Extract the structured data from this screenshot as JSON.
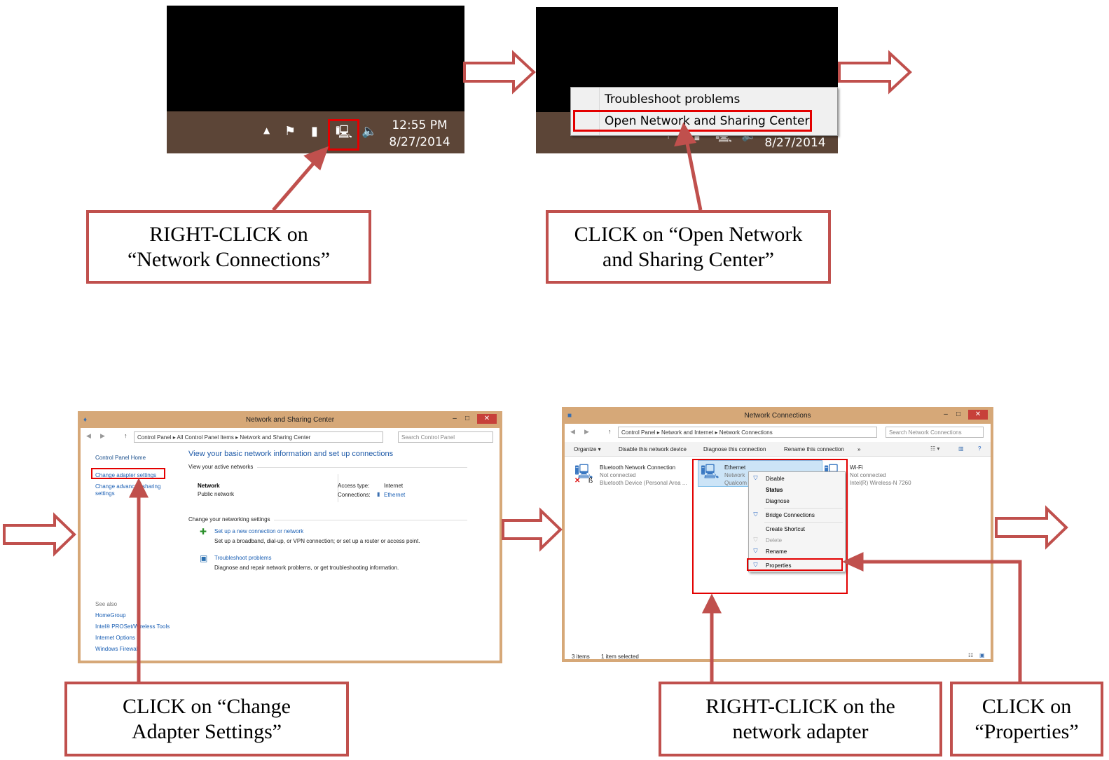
{
  "colors": {
    "arrow": "#c0504d",
    "highlight": "#e30000",
    "taskbar": "#5c4537",
    "window_frame": "#d6a878"
  },
  "step1": {
    "time": "12:55 PM",
    "date": "8/27/2014",
    "icons": [
      "up-triangle-icon",
      "flag-icon",
      "battery-icon",
      "network-icon",
      "speaker-icon"
    ],
    "caption": {
      "line1": "RIGHT-CLICK on",
      "line2": "“Network Connections”"
    }
  },
  "step2": {
    "date": "8/27/2014",
    "menu": [
      "Troubleshoot problems",
      "Open Network and Sharing Center"
    ],
    "caption": {
      "line1": "CLICK on “Open Network",
      "line2": "and Sharing Center”"
    }
  },
  "step3": {
    "title": "Network and Sharing Center",
    "address": [
      "Control Panel",
      "All Control Panel Items",
      "Network and Sharing Center"
    ],
    "search_placeholder": "Search Control Panel",
    "sidebar": {
      "home": "Control Panel Home",
      "change_adapter": "Change adapter settings",
      "change_advanced_1": "Change advanced sharing",
      "change_advanced_2": "settings",
      "see_also": "See also",
      "links": [
        "HomeGroup",
        "Intel® PROSet/Wireless Tools",
        "Internet Options",
        "Windows Firewall"
      ]
    },
    "heading": "View your basic network information and set up connections",
    "active_networks": "View your active networks",
    "network_name": "Network",
    "network_type": "Public network",
    "access_type_label": "Access type:",
    "access_type_value": "Internet",
    "connections_label": "Connections:",
    "connections_value": "Ethernet",
    "change_settings": "Change your networking settings",
    "setup_link": "Set up a new connection or network",
    "setup_desc": "Set up a broadband, dial-up, or VPN connection; or set up a router or access point.",
    "troubleshoot_link": "Troubleshoot problems",
    "troubleshoot_desc": "Diagnose and repair network problems, or get troubleshooting information.",
    "caption": {
      "line1": "CLICK on “Change",
      "line2": "Adapter Settings”"
    }
  },
  "step4": {
    "title": "Network Connections",
    "address": [
      "Control Panel",
      "Network and Internet",
      "Network Connections"
    ],
    "search_placeholder": "Search Network Connections",
    "toolbar": [
      "Organize ▾",
      "Disable this network device",
      "Diagnose this connection",
      "Rename this connection",
      "»"
    ],
    "adapters": [
      {
        "name": "Bluetooth Network Connection",
        "status": "Not connected",
        "device": "Bluetooth Device (Personal Area ..."
      },
      {
        "name": "Ethernet",
        "status": "Network",
        "device": "Qualcom"
      },
      {
        "name": "Wi-Fi",
        "status": "Not connected",
        "device": "Intel(R) Wireless-N 7260"
      }
    ],
    "menu": [
      "Disable",
      "Status",
      "Diagnose",
      "Bridge Connections",
      "Create Shortcut",
      "Delete",
      "Rename",
      "Properties"
    ],
    "status_items": "3 items",
    "status_selected": "1 item selected",
    "caption_adapter": {
      "line1": "RIGHT-CLICK on the",
      "line2": "network adapter"
    },
    "caption_properties": {
      "line1": "CLICK on",
      "line2": "“Properties”"
    }
  }
}
